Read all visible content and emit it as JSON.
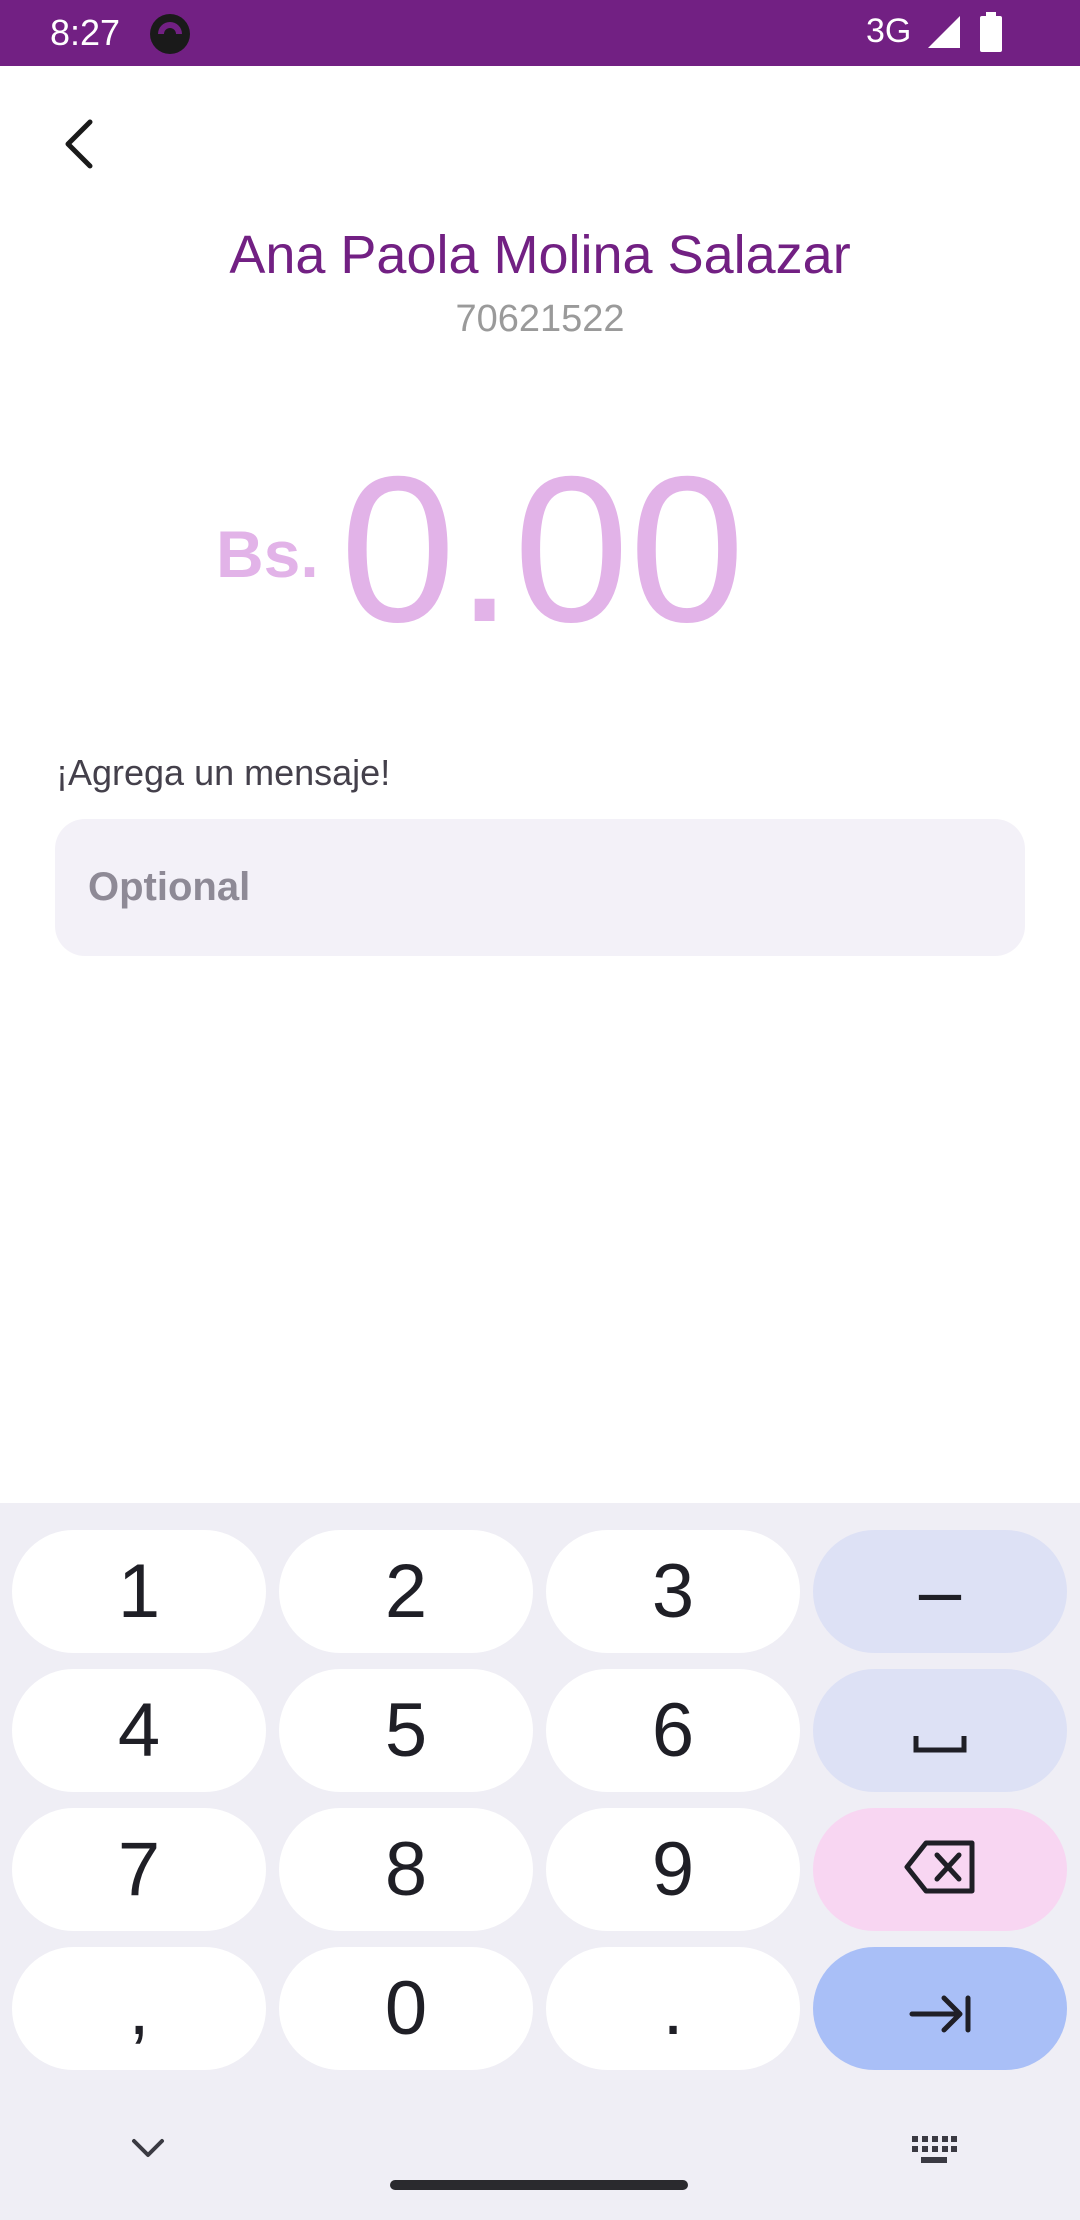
{
  "status_bar": {
    "time": "8:27",
    "network": "3G",
    "color": "#722083"
  },
  "contact": {
    "name": "Ana Paola Molina Salazar",
    "phone": "70621522"
  },
  "amount": {
    "currency": "Bs.",
    "value": "0.00"
  },
  "message": {
    "label": "¡Agrega un mensaje!",
    "placeholder": "Optional",
    "value": ""
  },
  "keyboard": {
    "keys": [
      "1",
      "2",
      "3",
      "–",
      "4",
      "5",
      "6",
      "␣",
      "7",
      "8",
      "9",
      "backspace",
      ",",
      "0",
      ".",
      "next"
    ]
  },
  "colors": {
    "brand": "#722083",
    "amount_tint": "#e2b3e8",
    "input_bg": "#f3f1f8"
  },
  "icons": [
    "back-arrow-icon",
    "signal-icon",
    "battery-icon",
    "backspace-icon",
    "tab-arrow-icon",
    "chevron-down-icon",
    "keyboard-icon"
  ]
}
